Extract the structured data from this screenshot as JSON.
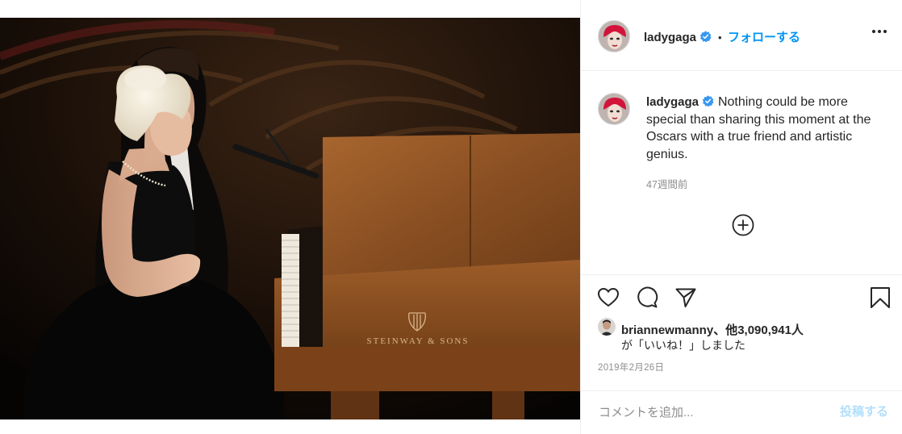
{
  "post": {
    "photo_brand_text": "STEINWAY & SONS",
    "author": {
      "username": "ladygaga",
      "verified": true,
      "follow_label": "フォローする",
      "separator": "•"
    },
    "caption": {
      "username": "ladygaga",
      "text": "Nothing could be more special than sharing this moment at the Oscars with a true friend and artistic genius.",
      "time_ago": "47週間前"
    },
    "likes": {
      "liker_username": "briannewmanny",
      "others_text": "、他3,090,941人",
      "suffix": "が「いいね！」しました"
    },
    "date": "2019年2月26日",
    "comment": {
      "placeholder": "コメントを追加...",
      "value": "",
      "post_label": "投稿する"
    }
  },
  "icons": {
    "more": "more-horizontal-icon",
    "load_more": "plus-circle-icon",
    "like": "heart-outline-icon",
    "comment": "comment-bubble-icon",
    "share": "paper-plane-icon",
    "save": "bookmark-icon",
    "verified": "verified-badge-icon"
  },
  "colors": {
    "link_blue": "#0095f6",
    "verified_blue": "#3897f0",
    "disabled_blue": "#b2dffc",
    "secondary_text": "#8e8e8e",
    "primary_text": "#262626",
    "divider": "#efefef"
  }
}
